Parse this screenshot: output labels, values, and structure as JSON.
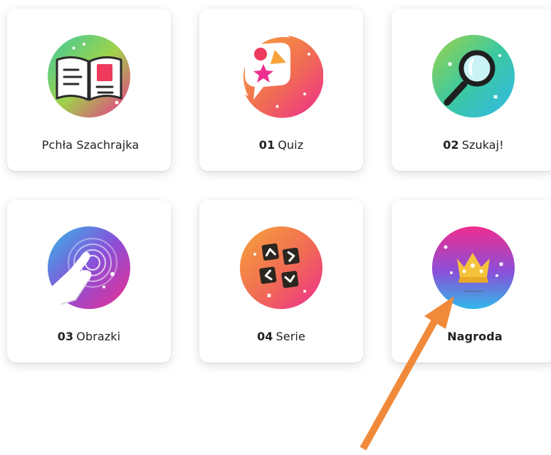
{
  "tiles": [
    {
      "num": "",
      "label": "Pchła Szachrajka",
      "icon": "open-book-icon"
    },
    {
      "num": "01",
      "label": "Quiz",
      "icon": "quiz-shapes-icon"
    },
    {
      "num": "02",
      "label": "Szukaj!",
      "icon": "magnifier-icon"
    },
    {
      "num": "03",
      "label": "Obrazki",
      "icon": "tap-hand-icon"
    },
    {
      "num": "04",
      "label": "Serie",
      "icon": "arrow-keys-icon"
    },
    {
      "num": "",
      "label": "Nagroda",
      "icon": "crown-icon"
    }
  ],
  "annotation": {
    "icon": "pointer-arrow",
    "color": "#f08a3a"
  },
  "colors": {
    "card_bg": "#ffffff",
    "text": "#222222",
    "gradient_pink": "#ee2d8f",
    "gradient_orange": "#f7a33a",
    "gradient_green": "#57d070",
    "gradient_blue": "#31b8e8",
    "gradient_purple": "#8a4fd8"
  }
}
